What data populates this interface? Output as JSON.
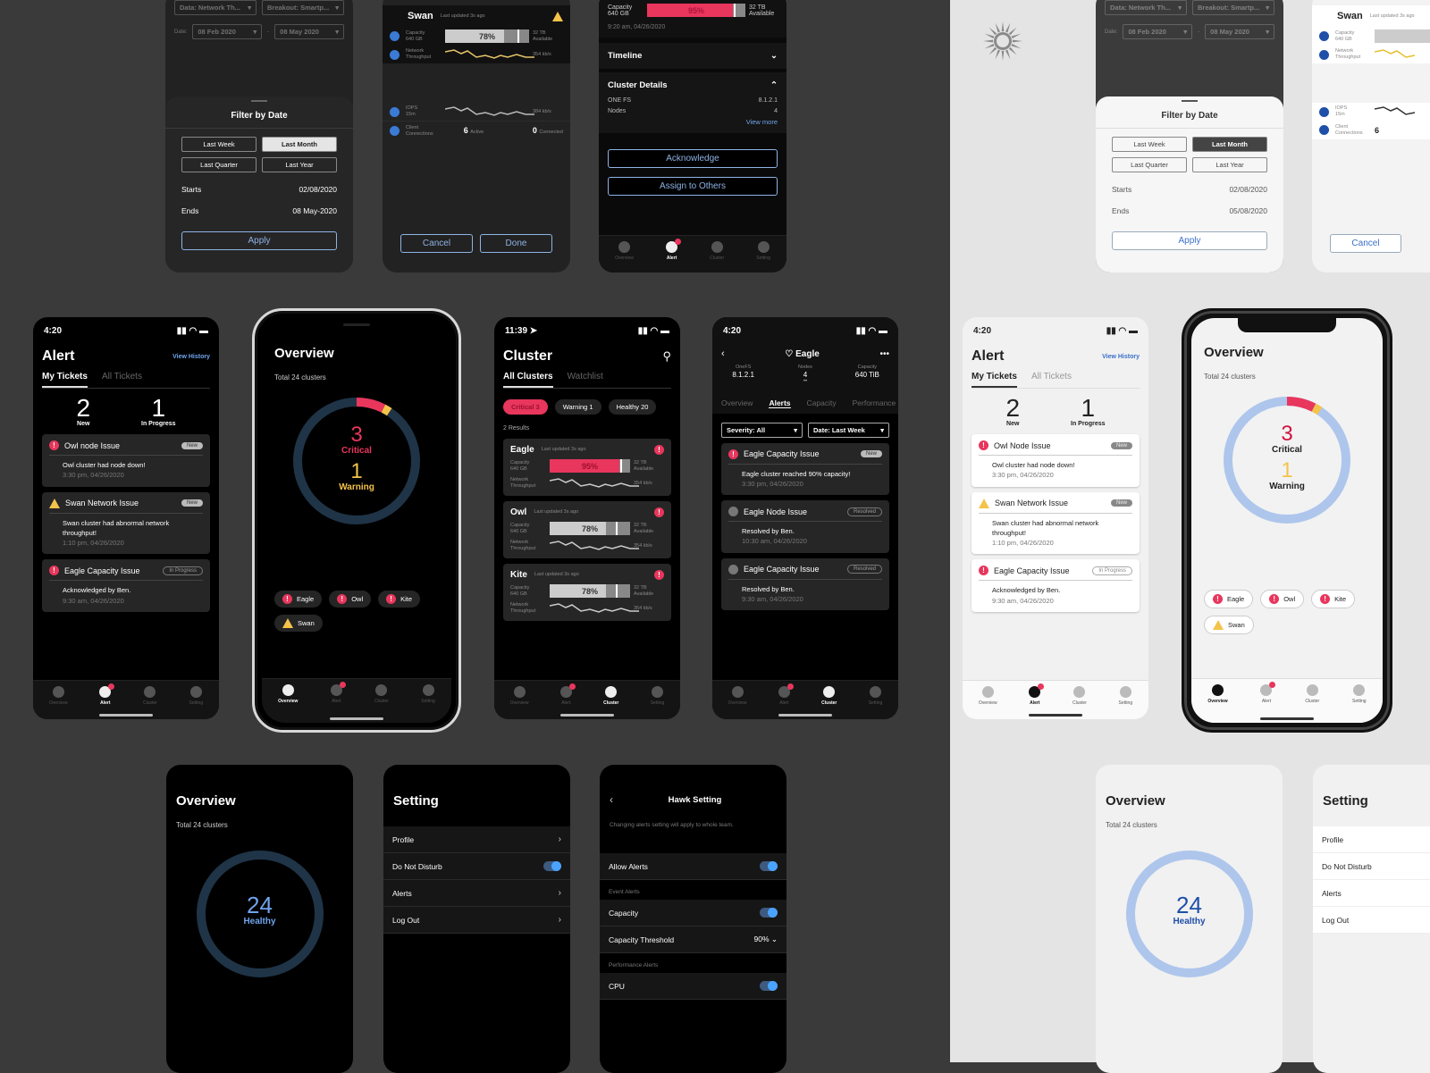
{
  "themes": {
    "dark": {
      "icon": "moon-icon"
    },
    "light": {
      "icon": "sun-icon"
    }
  },
  "colors": {
    "critical": "#e8365d",
    "warning": "#f3c34a",
    "healthy_dark": "#1f3447",
    "healthy_light": "#aec6ec",
    "accent_link": "#6fa4ec",
    "toggle_on": "#4aa3ff"
  },
  "filter_sheet": {
    "bg_fields": {
      "data": "Data: Network Th...",
      "breakout": "Breakout: Smartp...",
      "date_label": "Date:",
      "from": "08 Feb 2020",
      "to": "08 May 2020"
    },
    "title": "Filter by Date",
    "options": [
      "Last Week",
      "Last Month",
      "Last Quarter",
      "Last Year"
    ],
    "selected": "Last Month",
    "starts_label": "Starts",
    "starts_value": "02/08/2020",
    "ends_label": "Ends",
    "ends_value_dark": "08 May-2020",
    "ends_value_light": "05/08/2020",
    "apply": "Apply"
  },
  "swan_metrics": {
    "name": "Swan",
    "updated": "Last updated 3s ago",
    "capacity_label": "Capacity",
    "capacity_size": "640 GB",
    "capacity_pct": "78%",
    "capacity_fraction": 0.78,
    "available": "32 TB",
    "available_label": "Available",
    "network_label": "Network",
    "network_label2": "Throughput",
    "network_value": "354 kb/s",
    "iops_label": "IOPS",
    "iops_label2": "15m",
    "iops_value": "384 kb/s",
    "client_label": "Client",
    "client_label2": "Connections",
    "active_count": "6",
    "active_label": "Active",
    "connected_count": "0",
    "connected_label": "Connected",
    "cancel": "Cancel",
    "done": "Done"
  },
  "alert_detail": {
    "capacity_label": "Capacity",
    "capacity_size": "640 GB",
    "capacity_pct": "95%",
    "capacity_fraction": 0.95,
    "available": "32 TB",
    "available_label": "Available",
    "timestamp": "9:20 am, 04/26/2020",
    "timeline": "Timeline",
    "cluster_details": "Cluster Details",
    "onefs_label": "ONE FS",
    "onefs_value": "8.1.2.1",
    "nodes_label": "Nodes",
    "nodes_value": "4",
    "view_more": "View more",
    "acknowledge": "Acknowledge",
    "assign": "Assign to Others"
  },
  "nav": [
    "Overview",
    "Alert",
    "Cluster",
    "Setting"
  ],
  "alert_screen": {
    "time": "4:20",
    "title": "Alert",
    "view_history": "View History",
    "tabs": [
      "My Tickets",
      "All Tickets"
    ],
    "new_count": "2",
    "new_label": "New",
    "progress_count": "1",
    "progress_label": "In Progress",
    "tickets": [
      {
        "severity": "critical",
        "title": "Owl node Issue",
        "title_light": "Owl Node Issue",
        "status": "New",
        "body": "Owl cluster had node down!",
        "time": "3:30 pm, 04/26/2020"
      },
      {
        "severity": "warning",
        "title": "Swan Network Issue",
        "title_light": "Swan Network Issue",
        "status": "New",
        "body": "Swan cluster had abnormal network throughput!",
        "time": "1:10 pm, 04/26/2020"
      },
      {
        "severity": "critical",
        "title": "Eagle Capacity Issue",
        "title_light": "Eagle Capacity Issue",
        "status": "In Progress",
        "body": "Acknowledged by Ben.",
        "time": "9:30 am, 04/26/2020"
      }
    ]
  },
  "overview_screen": {
    "title": "Overview",
    "subtitle": "Total 24 clusters",
    "critical_count": "3",
    "critical_label": "Critical",
    "warning_count": "1",
    "warning_label": "Warning",
    "total": 24,
    "chips": [
      {
        "severity": "critical",
        "name": "Eagle"
      },
      {
        "severity": "critical",
        "name": "Owl"
      },
      {
        "severity": "critical",
        "name": "Kite"
      },
      {
        "severity": "warning",
        "name": "Swan"
      }
    ],
    "healthy_count": "24",
    "healthy_label": "Healthy"
  },
  "cluster_screen": {
    "time": "11:39",
    "title": "Cluster",
    "tabs": [
      "All Clusters",
      "Watchlist"
    ],
    "filters": [
      "Critical 3",
      "Warning 1",
      "Healthy 20"
    ],
    "results": "2 Results",
    "clusters": [
      {
        "name": "Eagle",
        "updated": "Last updated 3s ago",
        "capacity_pct": "95%",
        "fraction": 0.95,
        "size": "640 GB",
        "available": "32 TB",
        "net": "354 kb/s"
      },
      {
        "name": "Owl",
        "updated": "Last updated 3s ago",
        "capacity_pct": "78%",
        "fraction": 0.78,
        "size": "640 GB",
        "available": "32 TB",
        "net": "354 kb/s"
      },
      {
        "name": "Kite",
        "updated": "Last updated 3s ago",
        "capacity_pct": "78%",
        "fraction": 0.78,
        "size": "640 GB",
        "available": "32 TB",
        "net": "354 kb/s"
      }
    ]
  },
  "eagle_screen": {
    "time": "4:20",
    "title": "Eagle",
    "stats": [
      {
        "label": "OneFS",
        "value": "8.1.2.1"
      },
      {
        "label": "Nodes",
        "value": "4"
      },
      {
        "label": "Capacity",
        "value": "640 TiB"
      }
    ],
    "tabs": [
      "Overview",
      "Alerts",
      "Capacity",
      "Performance"
    ],
    "severity_filter": "Severity: All",
    "date_filter": "Date: Last Week",
    "alerts": [
      {
        "severity": "critical",
        "title": "Eagle Capacity Issue",
        "status": "New",
        "body": "Eagle cluster reached 90% capacity!",
        "time": "3:30 pm, 04/26/2020"
      },
      {
        "severity": "resolved",
        "title": "Eagle Node Issue",
        "status": "Resolved",
        "body": "Resolved by Ben.",
        "time": "10:30 am, 04/26/2020"
      },
      {
        "severity": "resolved",
        "title": "Eagle Capacity Issue",
        "status": "Resolved",
        "body": "Resolved by Ben.",
        "time": "9:30 am, 04/26/2020"
      }
    ]
  },
  "setting_screen": {
    "title": "Setting",
    "items": [
      "Profile",
      "Do Not Disturb",
      "Alerts",
      "Log Out"
    ],
    "do_not_disturb_on": true
  },
  "hawk_setting": {
    "title": "Hawk Setting",
    "note": "Changing alerts setting will apply to whole team.",
    "allow_alerts": "Allow Alerts",
    "event_section": "Event Alerts",
    "capacity": "Capacity",
    "threshold_label": "Capacity Threshold",
    "threshold_value": "90%",
    "performance_section": "Performance Alerts",
    "cpu": "CPU"
  }
}
